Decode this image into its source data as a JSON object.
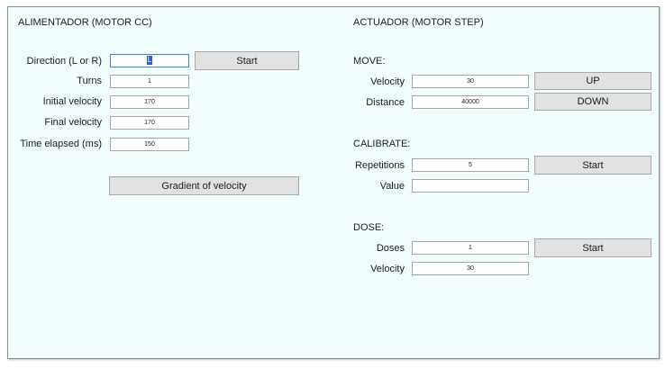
{
  "left": {
    "title": "ALIMENTADOR (MOTOR CC)",
    "direction_label": "Direction (L or R)",
    "direction_value": "L",
    "start_label": "Start",
    "turns_label": "Turns",
    "turns_value": "1",
    "initial_velocity_label": "Initial velocity",
    "initial_velocity_value": "170",
    "final_velocity_label": "Final velocity",
    "final_velocity_value": "170",
    "time_elapsed_label": "Time elapsed (ms)",
    "time_elapsed_value": "150",
    "gradient_label": "Gradient of velocity"
  },
  "right": {
    "title": "ACTUADOR (MOTOR STEP)",
    "move": {
      "heading": "MOVE:",
      "velocity_label": "Velocity",
      "velocity_value": "30",
      "up_label": "UP",
      "distance_label": "Distance",
      "distance_value": "40000",
      "down_label": "DOWN"
    },
    "calibrate": {
      "heading": "CALIBRATE:",
      "repetitions_label": "Repetitions",
      "repetitions_value": "5",
      "start_label": "Start",
      "value_label": "Value",
      "value_value": ""
    },
    "dose": {
      "heading": "DOSE:",
      "doses_label": "Doses",
      "doses_value": "1",
      "start_label": "Start",
      "velocity_label": "Velocity",
      "velocity_value": "30"
    }
  }
}
